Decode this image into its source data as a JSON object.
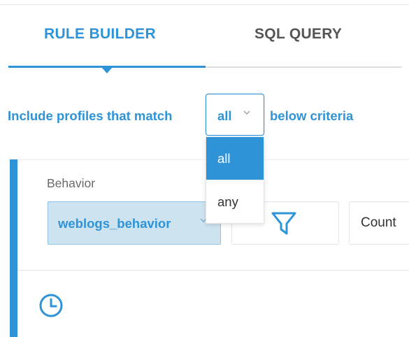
{
  "tabs": {
    "rule_builder": "RULE BUILDER",
    "sql_query": "SQL QUERY"
  },
  "include_sentence": {
    "prefix": "Include profiles that match",
    "selected": "all",
    "suffix": "below criteria"
  },
  "match_options": [
    "all",
    "any"
  ],
  "criteria": {
    "behavior_label": "Behavior",
    "behavior_value": "weblogs_behavior",
    "aggregate_value": "Count"
  },
  "colors": {
    "accent": "#2f93d8",
    "behavior_bg": "#cde3ef"
  },
  "icons": {
    "filter": "filter-icon",
    "clock": "clock-icon",
    "chevron": "chevron-down-icon"
  }
}
